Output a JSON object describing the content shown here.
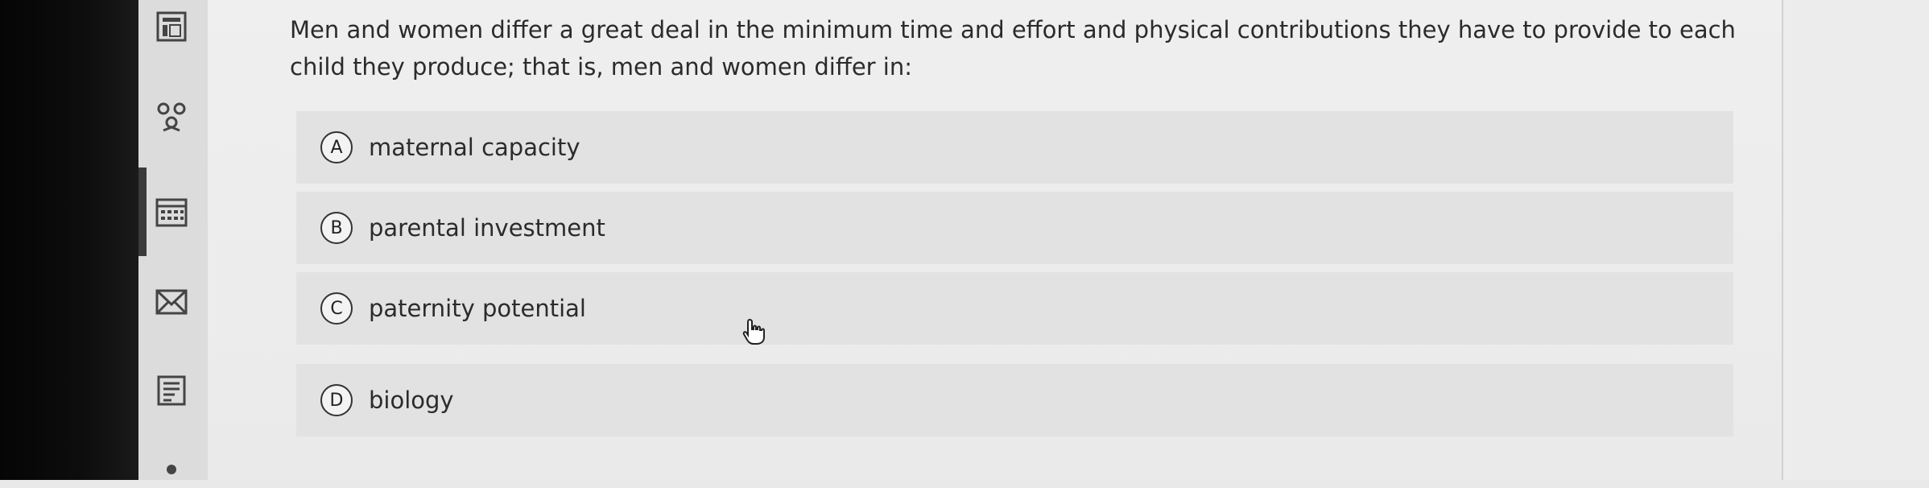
{
  "nav": {
    "icons": [
      "gradebook-icon",
      "people-icon",
      "calendar-icon",
      "inbox-icon",
      "history-icon"
    ]
  },
  "question": {
    "text": "Men and women differ a great deal in the minimum time and effort and physical contributions they have to provide to each child they produce; that is, men and women differ in:"
  },
  "options": [
    {
      "letter": "A",
      "label": "maternal capacity"
    },
    {
      "letter": "B",
      "label": "parental investment"
    },
    {
      "letter": "C",
      "label": "paternity potential"
    },
    {
      "letter": "D",
      "label": "biology"
    }
  ]
}
